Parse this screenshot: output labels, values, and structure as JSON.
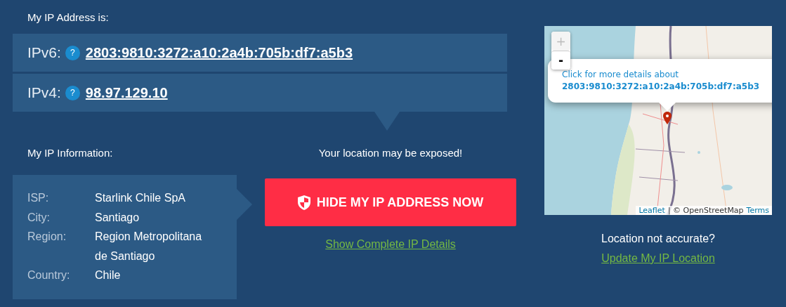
{
  "ip_address": {
    "heading": "My IP Address is:",
    "rows": [
      {
        "label": "IPv6:",
        "help": "?",
        "address": "2803:9810:3272:a10:2a4b:705b:df7:a5b3"
      },
      {
        "label": "IPv4:",
        "help": "?",
        "address": "98.97.129.10"
      }
    ]
  },
  "ip_information": {
    "heading": "My IP Information:",
    "fields": [
      {
        "label": "ISP:",
        "value": "Starlink Chile SpA"
      },
      {
        "label": "City:",
        "value": "Santiago"
      },
      {
        "label": "Region:",
        "value": "Region Metropolitana de Santiago"
      },
      {
        "label": "Country:",
        "value": "Chile"
      }
    ]
  },
  "warning": "Your location may be exposed!",
  "hide_button": "HIDE MY IP ADDRESS NOW",
  "details_link": "Show Complete IP Details",
  "map": {
    "zoom_in": {
      "label": "+",
      "disabled": true
    },
    "zoom_out": {
      "label": "-",
      "disabled": false
    },
    "popup": {
      "text": "Click for more details about",
      "address": "2803:9810:3272:a10:2a4b:705b:df7:a5b3"
    },
    "attribution": {
      "leaflet": "Leaflet",
      "separator": "| © OpenStreetMap",
      "terms": "Terms"
    }
  },
  "location": {
    "question": "Location not accurate?",
    "link": "Update My IP Location"
  }
}
